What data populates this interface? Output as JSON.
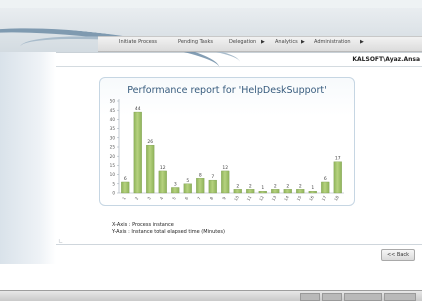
{
  "nav": {
    "items": [
      {
        "label": "Initiate Process",
        "has_arrow": false
      },
      {
        "label": "Pending Tasks",
        "has_arrow": false
      },
      {
        "label": "Delegation",
        "has_arrow": true
      },
      {
        "label": "Analytics",
        "has_arrow": true
      },
      {
        "label": "Administration",
        "has_arrow": true
      }
    ]
  },
  "user": {
    "name": "KALSOFT\\Ayaz.Ansa"
  },
  "report": {
    "title": "Performance report for 'HelpDeskSupport'"
  },
  "legend": {
    "x_axis": "X-Axis : Process instance",
    "y_axis": "Y-Axis : Instance total elapsed time (Minutes)"
  },
  "buttons": {
    "back": "<< Back"
  },
  "colors": {
    "bar_fill": "#8fb35a",
    "bar_top": "#b6d27f",
    "title": "#385c7e",
    "panel_border": "#c6d6e3"
  },
  "chart_data": {
    "type": "bar",
    "title": "Performance report for 'HelpDeskSupport'",
    "xlabel": "Process instance",
    "ylabel": "Instance total elapsed time (Minutes)",
    "ylim": [
      0,
      50
    ],
    "yticks": [
      0,
      5,
      10,
      15,
      20,
      25,
      30,
      35,
      40,
      45,
      50
    ],
    "categories": [
      "1",
      "2",
      "3",
      "4",
      "5",
      "6",
      "7",
      "8",
      "9",
      "10",
      "11",
      "12",
      "13",
      "14",
      "15",
      "16",
      "17",
      "18"
    ],
    "values": [
      6,
      44,
      26,
      12,
      3,
      5,
      8,
      7,
      12,
      2,
      2,
      1,
      2,
      2,
      2,
      1,
      6,
      17
    ],
    "grid": false
  }
}
